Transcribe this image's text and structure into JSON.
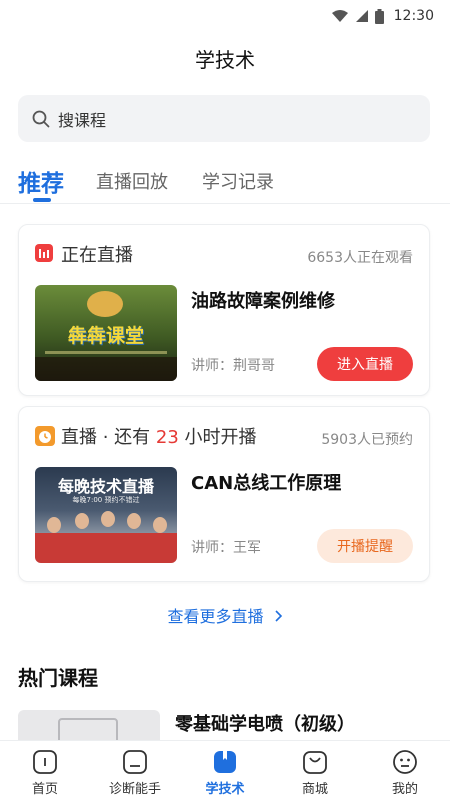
{
  "status_bar": {
    "time": "12:30"
  },
  "header": {
    "title": "学技术"
  },
  "search": {
    "placeholder": "搜课程"
  },
  "tabs": [
    {
      "label": "推荐",
      "active": true
    },
    {
      "label": "直播回放",
      "active": false
    },
    {
      "label": "学习记录",
      "active": false
    }
  ],
  "live_card": {
    "status": "正在直播",
    "viewers": "6653人正在观看",
    "course_title": "油路故障案例维修",
    "teacher": "讲师：荆哥哥",
    "button": "进入直播",
    "thumb_text": "犇犇课堂"
  },
  "upcoming_card": {
    "status_prefix": "直播 · 还有",
    "hours": "23",
    "status_suffix": "小时开播",
    "reservations": "5903人已预约",
    "course_title": "CAN总线工作原理",
    "teacher": "讲师：王军",
    "button": "开播提醒",
    "thumb_title": "每晚技术直播",
    "thumb_sub": "每晚7:00  预约不错过"
  },
  "more_link": {
    "label": "查看更多直播"
  },
  "hot_section": {
    "title": "热门课程",
    "first_course": "零基础学电喷（初级）"
  },
  "tabbar": [
    {
      "label": "首页",
      "icon": "home-icon",
      "active": false
    },
    {
      "label": "诊断能手",
      "icon": "diagnose-icon",
      "active": false
    },
    {
      "label": "学技术",
      "icon": "book-icon",
      "active": true
    },
    {
      "label": "商城",
      "icon": "shop-bag-icon",
      "active": false
    },
    {
      "label": "我的",
      "icon": "profile-icon",
      "active": false
    }
  ],
  "colors": {
    "accent": "#1f6fde",
    "live_red": "#ef3e3e",
    "remind_orange": "#e8681f"
  }
}
